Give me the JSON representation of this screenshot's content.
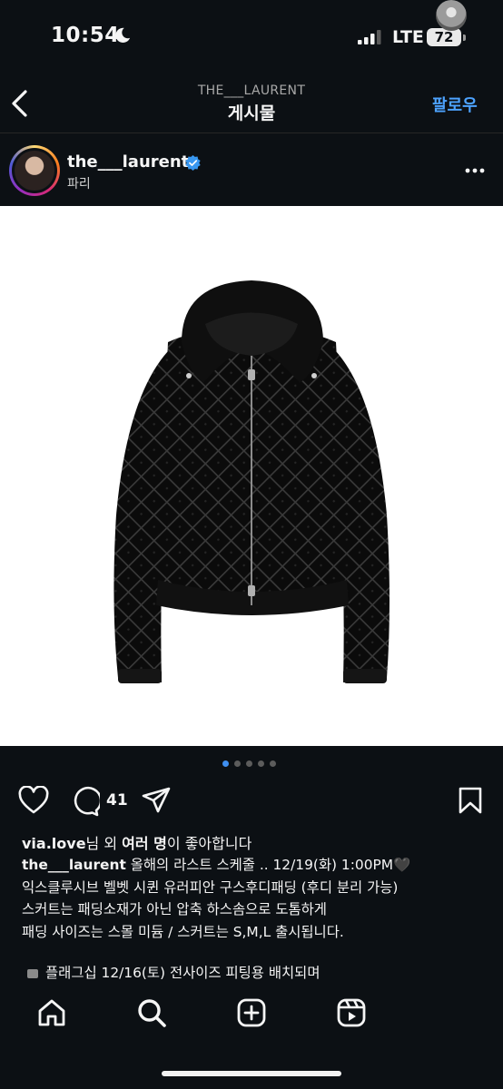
{
  "status_bar": {
    "time": "10:54",
    "network": "LTE",
    "battery": "72"
  },
  "header": {
    "account": "THE___LAURENT",
    "title": "게시물",
    "follow_label": "팔로우"
  },
  "post": {
    "username": "the___laurent",
    "location": "파리",
    "image_alt": "black sequin quilted velvet hooded jacket",
    "carousel": {
      "count": 5,
      "active": 1
    },
    "comment_count": "41",
    "likes": {
      "user": "via.love",
      "middle": "님 외 ",
      "bold": "여러 명",
      "end": "이 좋아합니다"
    },
    "caption": {
      "first_line": "올해의 라스트 스케줄 .. 12/19(화) 1:00PM🖤",
      "lines": [
        "익스클루시브 벨벳 시퀸 유러피안 구스후디패딩 (후디 분리 가능)",
        "스커트는 패딩소재가 아닌 압축 하스솜으로 도톰하게",
        "패딩 사이즈는 스몰 미듐 / 스커트는 S,M,L 출시됩니다."
      ],
      "last_line": "플래그십 12/16(토) 전사이즈 피팅용 배치되며"
    }
  },
  "colors": {
    "background": "#0c1014",
    "accent": "#4da3ff",
    "verified": "#3897f0",
    "active_dot": "#3f8ff0"
  },
  "icons": [
    "moon-icon",
    "signal-icon",
    "back-chevron-icon",
    "verified-badge-icon",
    "more-icon",
    "heart-icon",
    "comment-icon",
    "share-icon",
    "bookmark-icon",
    "home-icon",
    "search-icon",
    "create-icon",
    "reels-icon"
  ]
}
